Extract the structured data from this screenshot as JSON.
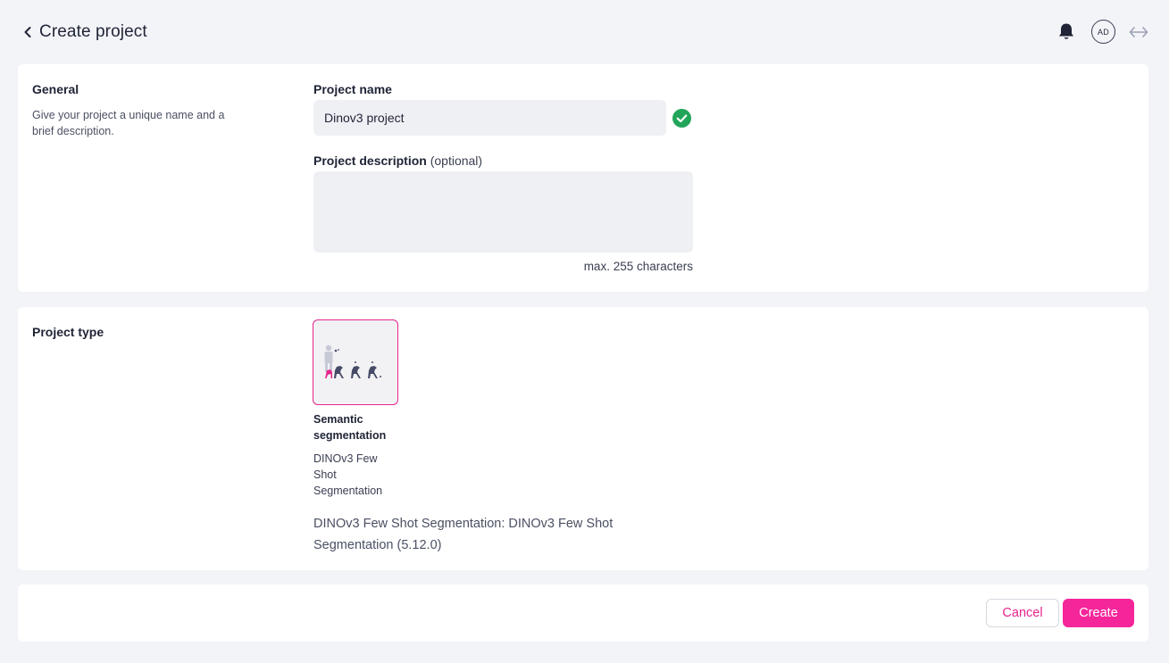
{
  "header": {
    "title": "Create project",
    "avatar_initials": "AD"
  },
  "general": {
    "title": "General",
    "description": "Give your project a unique name and a brief description.",
    "name_label": "Project name",
    "name_value": "Dinov3 project",
    "desc_label": "Project description",
    "desc_optional": "(optional)",
    "desc_value": "",
    "char_limit": "max. 255 characters"
  },
  "project_type": {
    "title": "Project type",
    "selected": {
      "name": "Semantic segmentation",
      "model": "DINOv3 Few Shot Segmentation",
      "full_label": "DINOv3 Few Shot Segmentation: DINOv3 Few Shot Segmentation (5.12.0)"
    }
  },
  "actions": {
    "cancel_label": "Cancel",
    "create_label": "Create"
  },
  "colors": {
    "accent": "#f5259a",
    "success": "#22a559",
    "background": "#f3f4f8"
  },
  "icons": {
    "back": "chevron-left-icon",
    "notifications": "bell-icon",
    "expand": "arrows-horizontal-icon",
    "valid": "check-circle-icon"
  }
}
